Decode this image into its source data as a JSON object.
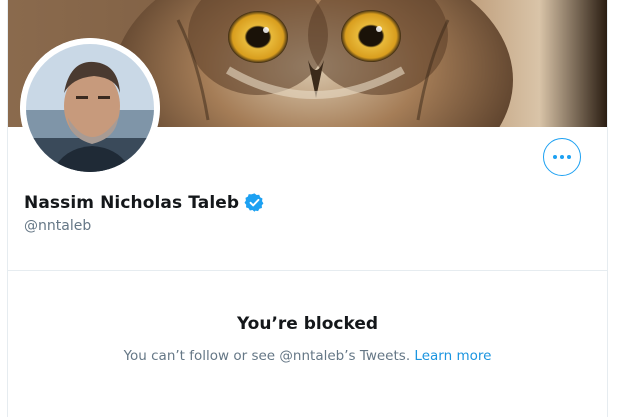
{
  "profile": {
    "display_name": "Nassim Nicholas Taleb",
    "handle": "@nntaleb",
    "verified": true,
    "banner_image": "owl-closeup",
    "avatar_image": "profile-photo"
  },
  "actions": {
    "more_icon": "more-horizontal-icon"
  },
  "blocked": {
    "title": "You’re blocked",
    "message": "You can’t follow or see @nntaleb’s Tweets.",
    "learn_more": "Learn more"
  },
  "colors": {
    "accent": "#1da1f2",
    "link": "#1b95e0",
    "text_primary": "#14171a",
    "text_secondary": "#657786",
    "border": "#e6ecf0"
  }
}
